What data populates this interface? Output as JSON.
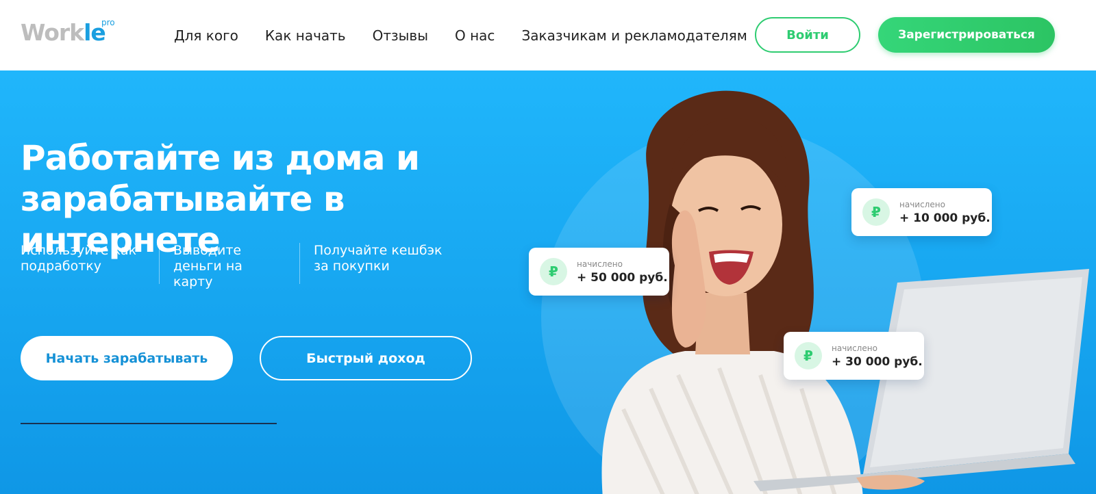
{
  "header": {
    "logo": {
      "main_1": "Work",
      "main_2": "le",
      "sup": "pro"
    },
    "nav": [
      {
        "label": "Для кого"
      },
      {
        "label": "Как начать"
      },
      {
        "label": "Отзывы"
      },
      {
        "label": "О нас"
      },
      {
        "label": "Заказчикам и рекламодателям"
      }
    ],
    "login_label": "Войти",
    "register_label": "Зарегистрироваться"
  },
  "hero": {
    "title_line1": "Работайте из дома и",
    "title_line2": "зарабатывайте в интернете",
    "features": [
      {
        "line1": "Используйте как",
        "line2": "подработку"
      },
      {
        "line1": "Выводите",
        "line2": "деньги на карту"
      },
      {
        "line1": "Получайте кешбэк",
        "line2": "за покупки"
      }
    ],
    "start_label": "Начать зарабатывать",
    "quick_label": "Быстрый доход",
    "cards": [
      {
        "icon": "ruble-icon",
        "symbol": "₽",
        "label": "начислено",
        "amount": "+ 50 000 руб."
      },
      {
        "icon": "ruble-icon",
        "symbol": "₽",
        "label": "начислено",
        "amount": "+ 10 000 руб."
      },
      {
        "icon": "ruble-icon",
        "symbol": "₽",
        "label": "начислено",
        "amount": "+ 30 000 руб."
      }
    ]
  },
  "colors": {
    "brand_green": "#2ecc71",
    "brand_blue": "#1a9fe0",
    "hero_blue": "#1aaef7"
  }
}
